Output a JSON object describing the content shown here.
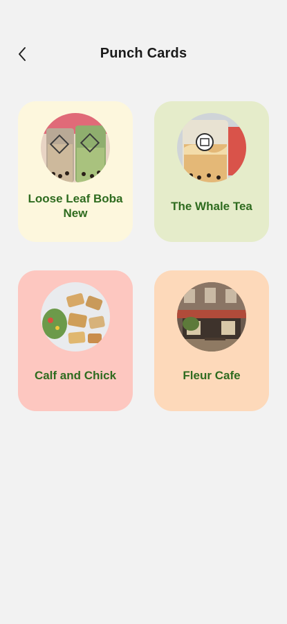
{
  "header": {
    "back_icon": "chevron-left-icon",
    "title": "Punch Cards"
  },
  "cards": [
    {
      "label": "Loose Leaf Boba New",
      "bg": "#fdf7dd",
      "image": "bubble-tea-cups"
    },
    {
      "label": "The Whale Tea",
      "bg": "#e5ecca",
      "image": "milk-tea-cup"
    },
    {
      "label": "Calf and Chick",
      "bg": "#fdc7c0",
      "image": "sandwich-platter"
    },
    {
      "label": "Fleur Cafe",
      "bg": "#fdd9ba",
      "image": "cafe-storefront"
    }
  ],
  "colors": {
    "background": "#f2f2f2",
    "label_text": "#2e6b1f",
    "title_text": "#1a1a1a"
  }
}
